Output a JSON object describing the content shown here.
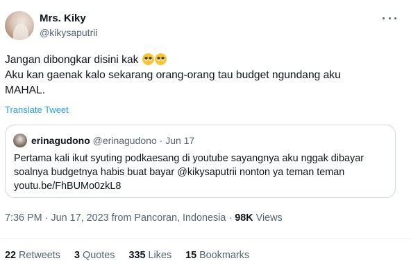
{
  "author": {
    "display_name": "Mrs. Kiky",
    "handle": "@kikysaputrii"
  },
  "tweet": {
    "line1": "Jangan dibongkar disini kak",
    "line1_emoji": "pleading-face-icon",
    "line2": "Aku kan gaenak kalo sekarang orang-orang tau budget ngundang aku",
    "line3": "MAHAL.",
    "translate_label": "Translate Tweet"
  },
  "quote": {
    "display_name": "erinagudono",
    "handle": "@erinagudono",
    "separator": "·",
    "date": "Jun 17",
    "lines": [
      "Pertama kali ikut syuting podkaesang di youtube sayangnya aku nggak dibayar",
      "soalnya budgetnya habis buat bayar @kikysaputrii nonton ya teman teman",
      "youtu.be/FhBUMo0zkL8"
    ]
  },
  "meta": {
    "time": "7:36 PM",
    "separator": "·",
    "date": "Jun 17, 2023",
    "location": "from Pancoran, Indonesia",
    "views_count": "98K",
    "views_label": "Views"
  },
  "stats": {
    "retweets_count": "22",
    "retweets_label": "Retweets",
    "quotes_count": "3",
    "quotes_label": "Quotes",
    "likes_count": "335",
    "likes_label": "Likes",
    "bookmarks_count": "15",
    "bookmarks_label": "Bookmarks"
  },
  "colors": {
    "link": "#1d9bf0",
    "secondary_text": "#536471",
    "border": "#cfd9de"
  }
}
